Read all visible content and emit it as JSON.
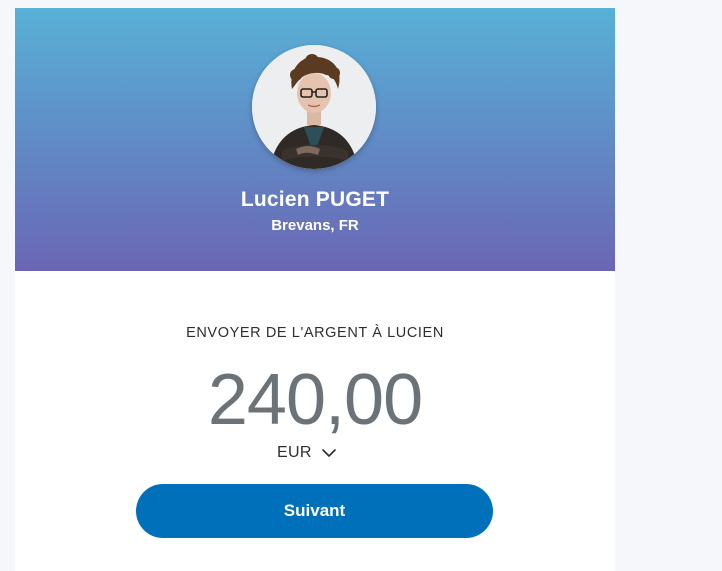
{
  "recipient": {
    "name": "Lucien PUGET",
    "location": "Brevans, FR",
    "avatar_alt": "profile-photo"
  },
  "send": {
    "label": "ENVOYER DE L'ARGENT À LUCIEN",
    "amount": "240,00",
    "currency": "EUR",
    "currency_icon": "chevron-down-icon"
  },
  "actions": {
    "next_label": "Suivant"
  },
  "colors": {
    "gradient_top": "#58b1d6",
    "gradient_bottom": "#6b66b4",
    "primary_button": "#0070ba",
    "amount_text": "#6c7378"
  }
}
